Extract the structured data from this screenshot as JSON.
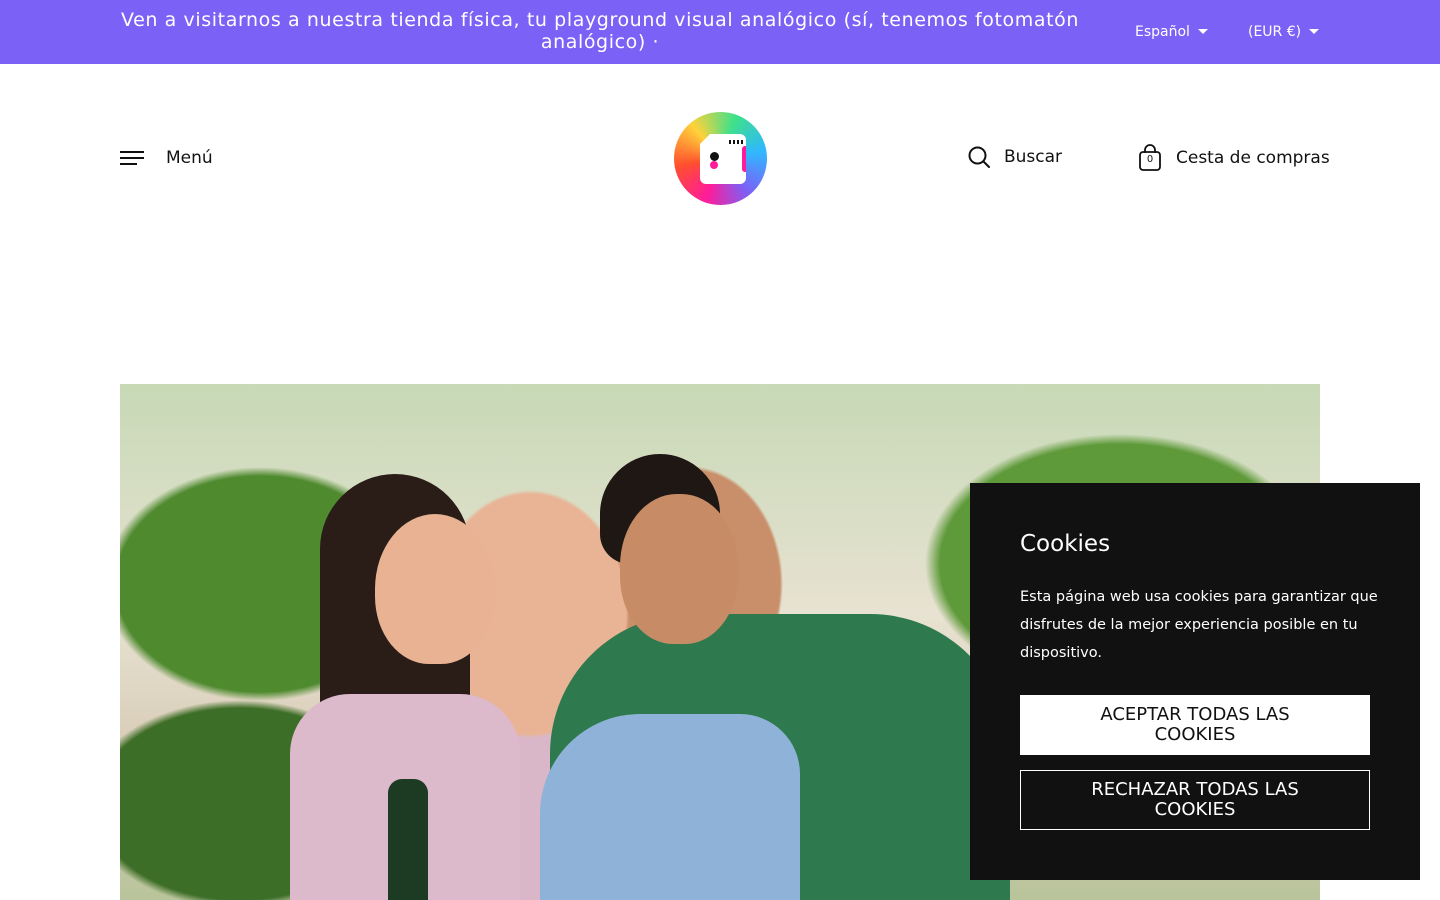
{
  "announcement": {
    "text": "Ven a visitarnos a nuestra tienda física, tu playground visual analógico (sí, tenemos fotomatón analógico) ·"
  },
  "locale": {
    "language": "Español",
    "currency": "(EUR €)"
  },
  "header": {
    "menu_label": "Menú",
    "search_label": "Buscar",
    "cart_label": "Cesta de compras",
    "cart_count": "0"
  },
  "cookie_banner": {
    "title": "Cookies",
    "text": "Esta página web usa cookies para garantizar que disfrutes de la mejor experiencia posible en tu dispositivo.",
    "accept_label": "ACEPTAR TODAS LAS COOKIES",
    "reject_label": "RECHAZAR TODAS LAS COOKIES"
  },
  "colors": {
    "announcement_bg": "#7b61f6",
    "cookie_bg": "#111111",
    "text": "#111111"
  },
  "icons": {
    "menu": "hamburger-icon",
    "search": "search-icon",
    "cart": "shopping-bag-icon",
    "dropdown": "caret-down-icon"
  }
}
